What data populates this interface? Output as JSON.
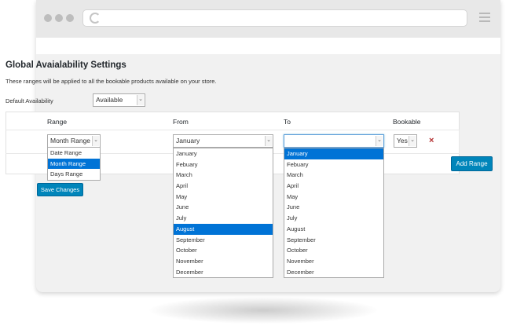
{
  "settings": {
    "title": "Global Avaialability Settings",
    "description": "These ranges will be applied to all the bookable products available on your store.",
    "default_availability_label": "Default Availability",
    "default_availability_value": "Available"
  },
  "table": {
    "headers": {
      "range": "Range",
      "from": "From",
      "to": "To",
      "bookable": "Bookable"
    },
    "row": {
      "range_value": "Month Range",
      "from_value": "January",
      "to_value": "",
      "bookable_value": "Yes"
    },
    "range_options": [
      "Date Range",
      "Month Range",
      "Days Range"
    ],
    "range_selected": 1,
    "months": [
      "January",
      "Febuary",
      "March",
      "April",
      "May",
      "June",
      "July",
      "August",
      "September",
      "October",
      "November",
      "December"
    ],
    "from_selected": 7,
    "to_selected": 0
  },
  "buttons": {
    "add_range": "Add Range",
    "save_changes": "Save Changes"
  },
  "icons": {
    "remove": "×",
    "dropdown": "⌄"
  },
  "colors": {
    "primary": "#0085ba",
    "selection": "#0073d6",
    "danger": "#b32d2e"
  }
}
